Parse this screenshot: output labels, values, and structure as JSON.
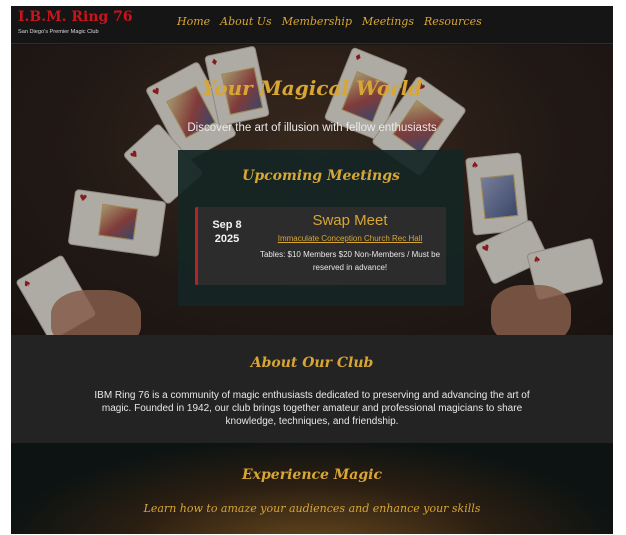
{
  "header": {
    "logo_title": "I.B.M. Ring 76",
    "logo_subtitle": "San Diego's Premier Magic Club",
    "nav": [
      "Home",
      "About Us",
      "Membership",
      "Meetings",
      "Resources"
    ]
  },
  "hero": {
    "title": "Your Magical World",
    "subtitle": "Discover the art of illusion with fellow enthusiasts"
  },
  "meetings": {
    "heading": "Upcoming Meetings",
    "items": [
      {
        "date_day": "Sep 8",
        "date_year": "2025",
        "title": "Swap Meet",
        "location": "Immaculate Conception Church Rec Hall",
        "description": "Tables: $10 Members $20 Non-Members / Must be reserved in advance!"
      }
    ]
  },
  "about": {
    "heading": "About Our Club",
    "text": "IBM Ring 76 is a community of magic enthusiasts dedicated to preserving and advancing the art of magic. Founded in 1942, our club brings together amateur and professional magicians to share knowledge, techniques, and friendship."
  },
  "experience": {
    "heading": "Experience Magic",
    "subtitle": "Learn how to amaze your audiences and enhance your skills"
  },
  "colors": {
    "accent_gold": "#d8a634",
    "brand_red": "#c8141c",
    "panel_teal": "#142624"
  }
}
